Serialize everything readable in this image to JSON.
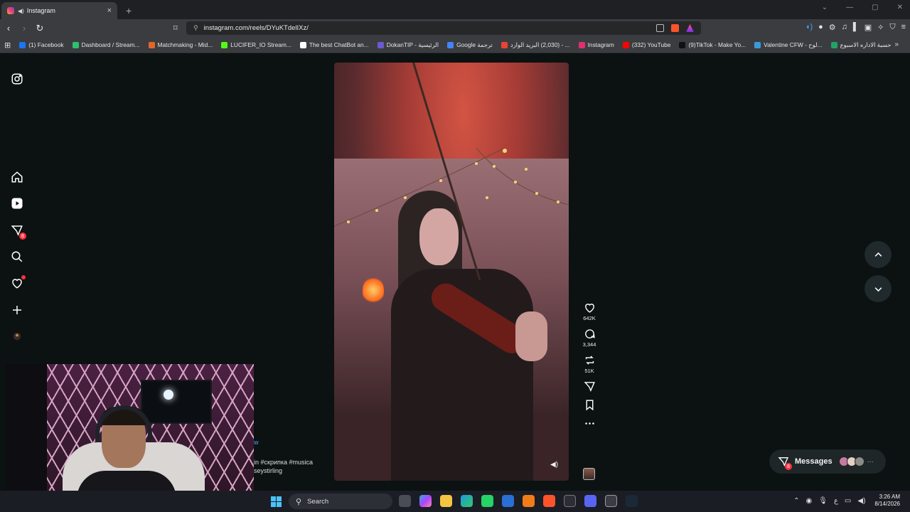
{
  "browser": {
    "tab": {
      "title": "Instagram",
      "close": "×"
    },
    "new_tab": "+",
    "window_controls": [
      "⌄",
      "—",
      "▢",
      "✕"
    ],
    "url": "instagram.com/reels/DYuKTdelIXz/"
  },
  "bookmarks": [
    {
      "label": "(1) Facebook",
      "color": "#1877f2"
    },
    {
      "label": "Dashboard / Stream...",
      "color": "#2fbf71"
    },
    {
      "label": "Matchmaking - Mid...",
      "color": "#e0672b"
    },
    {
      "label": "LUCIFER_IO Stream...",
      "color": "#53fc18"
    },
    {
      "label": "The best ChatBot an...",
      "color": "#ffffff"
    },
    {
      "label": "DokanTIP - الرئيسية",
      "color": "#6a5acd"
    },
    {
      "label": "Google ترجمة",
      "color": "#4285f4"
    },
    {
      "label": "البريد الوارد ‎(2,030)‎ - ...",
      "color": "#ea4335"
    },
    {
      "label": "Instagram",
      "color": "#e1306c"
    },
    {
      "label": "(332) YouTube",
      "color": "#ff0000"
    },
    {
      "label": "(9)TikTok - Make Yo...",
      "color": "#111111"
    },
    {
      "label": "Valentine CFW - لوح...",
      "color": "#3a9ad9"
    },
    {
      "label": "حسبة الاداره الاسبوع",
      "color": "#21a366"
    }
  ],
  "sidebar": {
    "messages_badge": "8"
  },
  "reel": {
    "likes": "642K",
    "comments": "3,344",
    "reposts": "51K",
    "caption_line1": "in #скрипка #musica",
    "caption_line2": "seystirling",
    "caption_frag": "w"
  },
  "messages": {
    "label": "Messages",
    "badge": "8",
    "more": "···"
  },
  "taskbar": {
    "search_placeholder": "Search",
    "tray_lang": "ع",
    "time": "3:26 AM",
    "date": "8/14/2026"
  }
}
